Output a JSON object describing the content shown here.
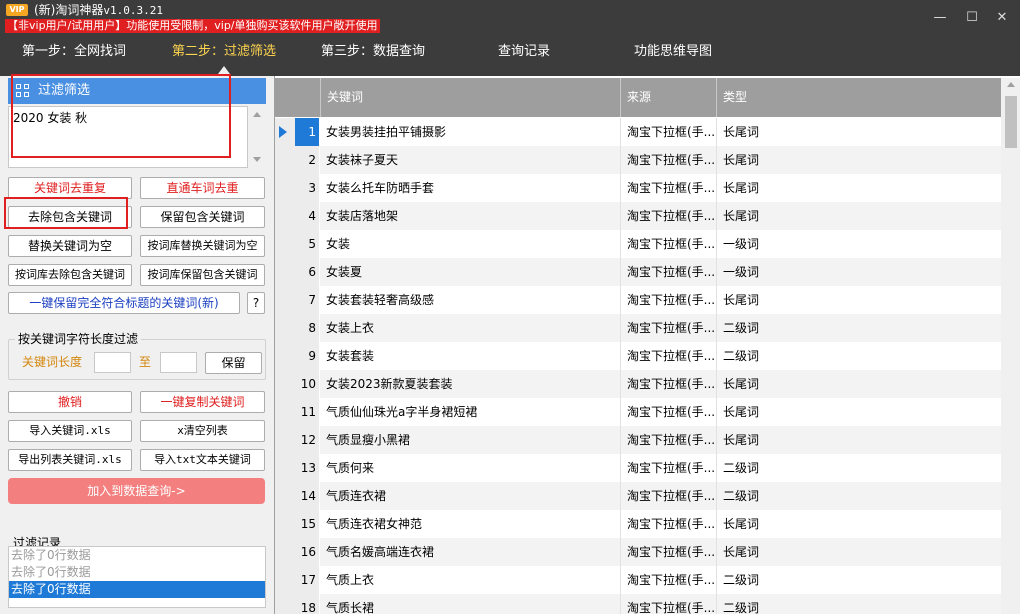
{
  "window": {
    "vip_badge": "VIP",
    "title": "(新)淘词神器",
    "version": "v1.0.3.21",
    "warning": "【非vip用户/试用用户】功能使用受限制，vip/单独购买该软件用户敞开使用",
    "controls": {
      "minimize": "—",
      "maximize": "☐",
      "close": "✕"
    }
  },
  "nav": {
    "step1": "第一步：全网找词",
    "step2": "第二步：过滤筛选",
    "step3": "第三步：数据查询",
    "history": "查询记录",
    "mindmap": "功能思维导图"
  },
  "filter": {
    "header": "过滤筛选",
    "keywords": "2020 女装 秋",
    "buttons": {
      "dedupe_kw": "关键词去重复",
      "dedupe_train": "直通车词去重",
      "remove_contains": "去除包含关键词",
      "keep_contains": "保留包含关键词",
      "replace_empty": "替换关键词为空",
      "lib_replace_empty": "按词库替换关键词为空",
      "lib_remove_contains": "按词库去除包含关键词",
      "lib_keep_contains": "按词库保留包含关键词",
      "keep_title_match": "一键保留完全符合标题的关键词(新)",
      "help": "?"
    },
    "length_group": {
      "title": "按关键词字符长度过滤",
      "label": "关键词长度",
      "to": "至",
      "min": "",
      "max": "",
      "keep": "保留"
    },
    "actions": {
      "undo": "撤销",
      "copy_all": "一键复制关键词",
      "import_xls": "导入关键词.xls",
      "clear_list": "x清空列表",
      "export_xls": "导出列表关键词.xls",
      "import_txt": "导入txt文本关键词",
      "add_to_query": "加入到数据查询->"
    },
    "log": {
      "title": "过滤记录",
      "items": [
        "去除了0行数据",
        "去除了0行数据",
        "去除了0行数据"
      ]
    }
  },
  "table": {
    "columns": [
      "关键词",
      "来源",
      "类型"
    ],
    "rows": [
      [
        "1",
        "女装男装挂拍平铺摄影",
        "淘宝下拉框(手...",
        "长尾词"
      ],
      [
        "2",
        "女装袜子夏天",
        "淘宝下拉框(手...",
        "长尾词"
      ],
      [
        "3",
        "女装么托车防晒手套",
        "淘宝下拉框(手...",
        "长尾词"
      ],
      [
        "4",
        "女装店落地架",
        "淘宝下拉框(手...",
        "长尾词"
      ],
      [
        "5",
        "女装",
        "淘宝下拉框(手...",
        "一级词"
      ],
      [
        "6",
        "女装夏",
        "淘宝下拉框(手...",
        "一级词"
      ],
      [
        "7",
        "女装套装轻奢高级感",
        "淘宝下拉框(手...",
        "长尾词"
      ],
      [
        "8",
        "女装上衣",
        "淘宝下拉框(手...",
        "二级词"
      ],
      [
        "9",
        "女装套装",
        "淘宝下拉框(手...",
        "二级词"
      ],
      [
        "10",
        "女装2023新款夏装套装",
        "淘宝下拉框(手...",
        "长尾词"
      ],
      [
        "11",
        "气质仙仙珠光a字半身裙短裙",
        "淘宝下拉框(手...",
        "长尾词"
      ],
      [
        "12",
        "气质显瘦小黑裙",
        "淘宝下拉框(手...",
        "长尾词"
      ],
      [
        "13",
        "气质何来",
        "淘宝下拉框(手...",
        "二级词"
      ],
      [
        "14",
        "气质连衣裙",
        "淘宝下拉框(手...",
        "二级词"
      ],
      [
        "15",
        "气质连衣裙女神范",
        "淘宝下拉框(手...",
        "长尾词"
      ],
      [
        "16",
        "气质名媛高端连衣裙",
        "淘宝下拉框(手...",
        "长尾词"
      ],
      [
        "17",
        "气质上衣",
        "淘宝下拉框(手...",
        "二级词"
      ],
      [
        "18",
        "气质长裙",
        "淘宝下拉框(手...",
        "二级词"
      ]
    ]
  },
  "colors": {
    "titlebar": "#3c3c3c",
    "active_step": "#ffd54f",
    "accent": "#4a90e2",
    "selection": "#1e7ad6",
    "highlight_box": "#e02020",
    "add_button": "#f47f7f"
  }
}
